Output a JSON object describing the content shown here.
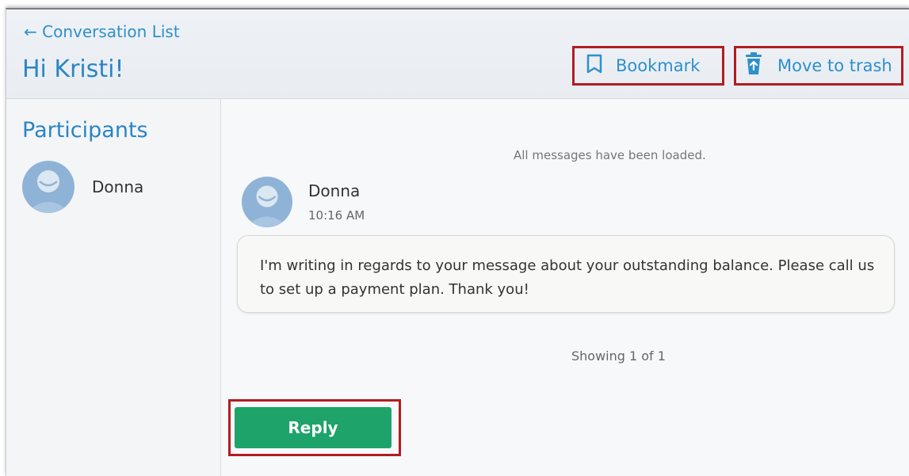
{
  "header": {
    "back_link": "← Conversation List",
    "title": "Hi Kristi!",
    "bookmark_label": "Bookmark",
    "trash_label": "Move to trash",
    "link_color": "#2f8fcb",
    "highlight_color": "#b11c22"
  },
  "sidebar": {
    "title": "Participants",
    "participants": [
      {
        "name": "Donna",
        "avatar_icon": "avatar-icon"
      }
    ]
  },
  "messages": {
    "status": "All messages have been loaded.",
    "items": [
      {
        "sender": "Donna",
        "time": "10:16 AM",
        "text": "I'm writing in regards to your message about your outstanding balance. Please call us to set up a payment plan. Thank you!"
      }
    ],
    "showing": "Showing 1 of 1"
  },
  "actions": {
    "reply_label": "Reply",
    "reply_color": "#1ea36a"
  }
}
